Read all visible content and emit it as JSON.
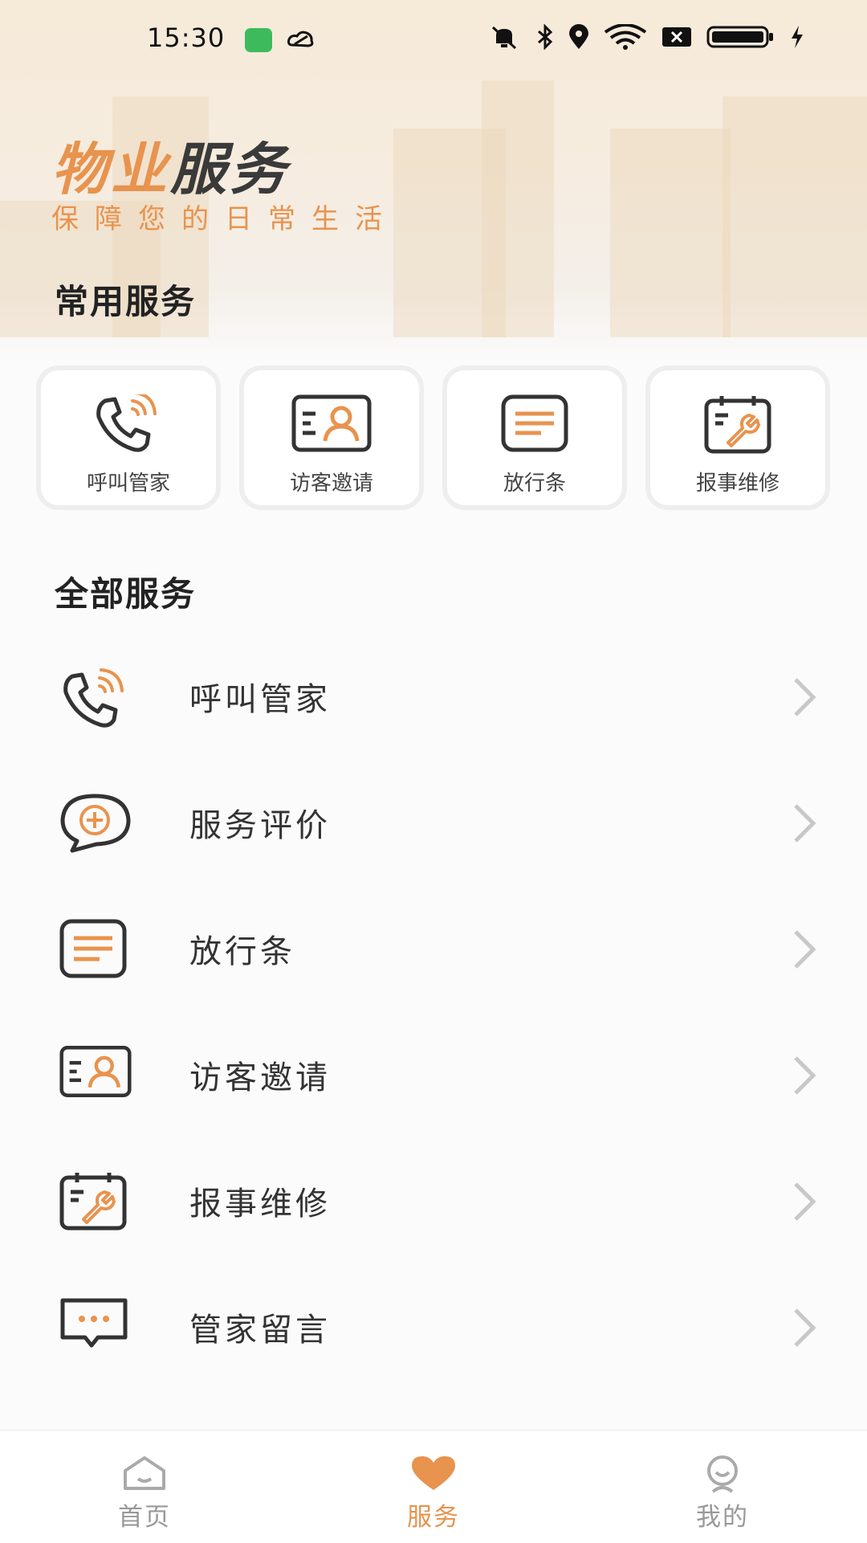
{
  "status_bar": {
    "time": "15:30"
  },
  "header": {
    "brand_part1": "物业",
    "brand_part2": "服务",
    "slogan": "保障您的日常生活"
  },
  "common_services": {
    "title": "常用服务",
    "items": [
      {
        "label": "呼叫管家",
        "icon": "phone-call-icon"
      },
      {
        "label": "访客邀请",
        "icon": "visitor-card-icon"
      },
      {
        "label": "放行条",
        "icon": "pass-note-icon"
      },
      {
        "label": "报事维修",
        "icon": "repair-calendar-icon"
      }
    ]
  },
  "all_services": {
    "title": "全部服务",
    "items": [
      {
        "label": "呼叫管家",
        "icon": "phone-call-icon"
      },
      {
        "label": "服务评价",
        "icon": "chat-plus-icon"
      },
      {
        "label": "放行条",
        "icon": "pass-note-icon"
      },
      {
        "label": "访客邀请",
        "icon": "visitor-card-icon"
      },
      {
        "label": "报事维修",
        "icon": "repair-calendar-icon"
      },
      {
        "label": "管家留言",
        "icon": "message-icon"
      }
    ]
  },
  "tab_bar": {
    "tabs": [
      {
        "label": "首页",
        "icon": "home-icon",
        "active": false
      },
      {
        "label": "服务",
        "icon": "heart-icon",
        "active": true
      },
      {
        "label": "我的",
        "icon": "profile-icon",
        "active": false
      }
    ]
  },
  "colors": {
    "accent": "#e8934e",
    "text": "#333333",
    "inactive": "#999999"
  }
}
